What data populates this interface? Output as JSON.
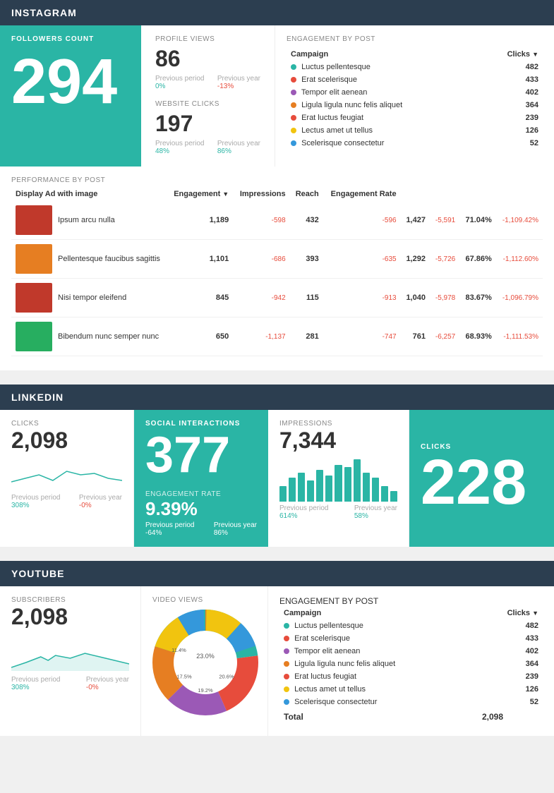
{
  "instagram": {
    "header": "INSTAGRAM",
    "followers": {
      "label": "FOLLOWERS COUNT",
      "value": "294"
    },
    "profile_views": {
      "label": "PROFILE VIEWS",
      "value": "86",
      "prev_period_label": "Previous period",
      "prev_period_val": "0%",
      "prev_year_label": "Previous year",
      "prev_year_val": "-13%"
    },
    "website_clicks": {
      "label": "WEBSITE CLICKS",
      "value": "197",
      "prev_period_label": "Previous period",
      "prev_period_val": "48%",
      "prev_year_label": "Previous year",
      "prev_year_val": "86%"
    },
    "engagement": {
      "section_label": "ENGAGEMENT BY POST",
      "col_campaign": "Campaign",
      "col_clicks": "Clicks",
      "items": [
        {
          "color": "#2ab5a5",
          "name": "Luctus pellentesque",
          "clicks": "482"
        },
        {
          "color": "#e74c3c",
          "name": "Erat scelerisque",
          "clicks": "433"
        },
        {
          "color": "#9b59b6",
          "name": "Tempor elit aenean",
          "clicks": "402"
        },
        {
          "color": "#e67e22",
          "name": "Ligula ligula nunc felis aliquet",
          "clicks": "364"
        },
        {
          "color": "#e74c3c",
          "name": "Erat luctus feugiat",
          "clicks": "239"
        },
        {
          "color": "#f1c40f",
          "name": "Lectus amet ut tellus",
          "clicks": "126"
        },
        {
          "color": "#3498db",
          "name": "Scelerisque consectetur",
          "clicks": "52"
        }
      ]
    },
    "performance": {
      "section_label": "PERFORMANCE BY POST",
      "display_label": "Display Ad with image",
      "col_engagement": "Engagement",
      "col_impressions": "Impressions",
      "col_reach": "Reach",
      "col_engagement_rate": "Engagement Rate",
      "posts": [
        {
          "title": "Ipsum arcu nulla",
          "color": "#c0392b",
          "engagement": "1,189",
          "eng_delta": "-598",
          "impressions": "432",
          "imp_delta": "-596",
          "reach": "1,427",
          "reach_delta": "-5,591",
          "eng_rate": "71.04%",
          "rate_delta": "-1,109.42%"
        },
        {
          "title": "Pellentesque faucibus sagittis",
          "color": "#e67e22",
          "engagement": "1,101",
          "eng_delta": "-686",
          "impressions": "393",
          "imp_delta": "-635",
          "reach": "1,292",
          "reach_delta": "-5,726",
          "eng_rate": "67.86%",
          "rate_delta": "-1,112.60%"
        },
        {
          "title": "Nisi tempor eleifend",
          "color": "#c0392b",
          "engagement": "845",
          "eng_delta": "-942",
          "impressions": "115",
          "imp_delta": "-913",
          "reach": "1,040",
          "reach_delta": "-5,978",
          "eng_rate": "83.67%",
          "rate_delta": "-1,096.79%"
        },
        {
          "title": "Bibendum nunc semper nunc",
          "color": "#27ae60",
          "engagement": "650",
          "eng_delta": "-1,137",
          "impressions": "281",
          "imp_delta": "-747",
          "reach": "761",
          "reach_delta": "-6,257",
          "eng_rate": "68.93%",
          "rate_delta": "-1,111.53%"
        }
      ]
    }
  },
  "linkedin": {
    "header": "LINKEDIN",
    "clicks": {
      "label": "CLICKS",
      "value": "2,098",
      "prev_period_label": "Previous period",
      "prev_period_val": "308%",
      "prev_year_label": "Previous year",
      "prev_year_val": "-0%"
    },
    "social_interactions": {
      "label": "SOCIAL INTERACTIONS",
      "value": "377"
    },
    "engagement_rate": {
      "label": "ENGAGEMENT RATE",
      "value": "9.39%",
      "prev_period_label": "Previous period",
      "prev_period_val": "-64%",
      "prev_year_label": "Previous year",
      "prev_year_val": "86%"
    },
    "impressions": {
      "label": "IMPRESSIONS",
      "value": "7,344",
      "prev_period_label": "Previous period",
      "prev_period_val": "614%",
      "prev_year_label": "Previous year",
      "prev_year_val": "58%",
      "bars": [
        30,
        45,
        55,
        40,
        60,
        50,
        70,
        65,
        80,
        55,
        45,
        30,
        20
      ]
    },
    "clicks_big": {
      "label": "CLICKS",
      "value": "228"
    }
  },
  "youtube": {
    "header": "YOUTUBE",
    "subscribers": {
      "label": "SUBSCRIBERS",
      "value": "2,098",
      "prev_period_label": "Previous period",
      "prev_period_val": "308%",
      "prev_year_label": "Previous year",
      "prev_year_val": "-0%"
    },
    "video_views": {
      "label": "VIDEO VIEWS",
      "pie_segments": [
        {
          "label": "Luctus pellentesque",
          "color": "#2ab5a5",
          "pct": 23.0,
          "offset": 0
        },
        {
          "label": "Erat scelerisque",
          "color": "#e74c3c",
          "pct": 20.6,
          "offset": 23
        },
        {
          "label": "Tempor elit aenean",
          "color": "#9b59b6",
          "pct": 19.2,
          "offset": 43.6
        },
        {
          "label": "Ligula ligula nunc felis aliquet",
          "color": "#e67e22",
          "pct": 17.5,
          "offset": 62.8
        },
        {
          "label": "Erat luctus feugiat",
          "color": "#f1c40f",
          "pct": 11.4,
          "offset": 80.3
        },
        {
          "label": "Scelerisque consectetur",
          "color": "#3498db",
          "pct": 8.3,
          "offset": 91.7
        }
      ],
      "labels": [
        "23.0%",
        "20.6%",
        "19.2%",
        "17.5%",
        "11.4%"
      ]
    },
    "engagement": {
      "section_label": "ENGAGEMENT BY POST",
      "col_campaign": "Campaign",
      "col_clicks": "Clicks",
      "items": [
        {
          "color": "#2ab5a5",
          "name": "Luctus pellentesque",
          "clicks": "482"
        },
        {
          "color": "#e74c3c",
          "name": "Erat scelerisque",
          "clicks": "433"
        },
        {
          "color": "#9b59b6",
          "name": "Tempor elit aenean",
          "clicks": "402"
        },
        {
          "color": "#e67e22",
          "name": "Ligula ligula nunc felis aliquet",
          "clicks": "364"
        },
        {
          "color": "#e74c3c",
          "name": "Erat luctus feugiat",
          "clicks": "239"
        },
        {
          "color": "#f1c40f",
          "name": "Lectus amet ut tellus",
          "clicks": "126"
        },
        {
          "color": "#3498db",
          "name": "Scelerisque consectetur",
          "clicks": "52"
        }
      ],
      "total_label": "Total",
      "total_value": "2,098"
    }
  }
}
